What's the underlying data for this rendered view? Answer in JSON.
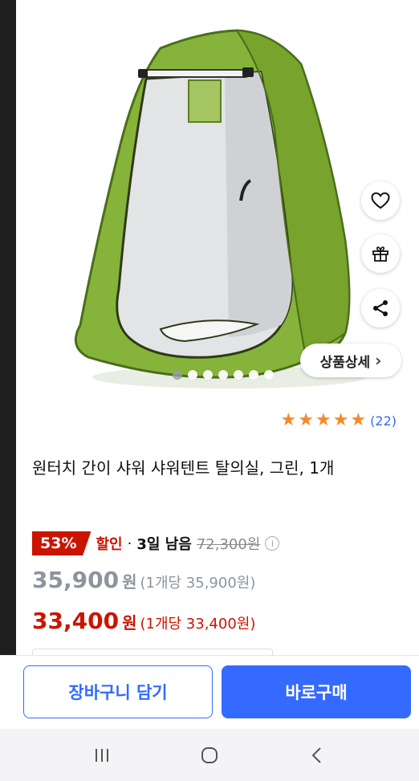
{
  "product": {
    "image_alt": "원터치 간이 샤워 샤워텐트 탈의실 그린 이미지",
    "image_dots": 7,
    "active_dot": 0,
    "title": "원터치 간이 샤워 샤워텐트 탈의실, 그린, 1개"
  },
  "actions": {
    "wishlist_icon": "heart-icon",
    "gift_icon": "gift-icon",
    "share_icon": "share-icon",
    "detail_label": "상품상세",
    "detail_chevron": "›"
  },
  "rating": {
    "stars": 5,
    "star_color": "#f5892a",
    "review_count": "(22)"
  },
  "pricing": {
    "discount_badge": "53%",
    "sale_label": "할인",
    "separator": "·",
    "time_left": "3일 남음",
    "original_price": "72,300원",
    "info_icon": "i",
    "price": "35,900",
    "price_unit": "원",
    "price_per_unit": "(1개당 35,900원)",
    "final_price": "33,400",
    "final_price_unit": "원",
    "final_price_per_unit": "(1개당 33,400원)",
    "accent_red": "#cb1400"
  },
  "buy_bar": {
    "cart_label": "장바구니 담기",
    "buy_label": "바로구매",
    "accent_blue": "#346aff"
  },
  "system_nav": {
    "recent_icon": "recent-apps-icon",
    "home_icon": "home-icon",
    "back_icon": "back-icon"
  }
}
